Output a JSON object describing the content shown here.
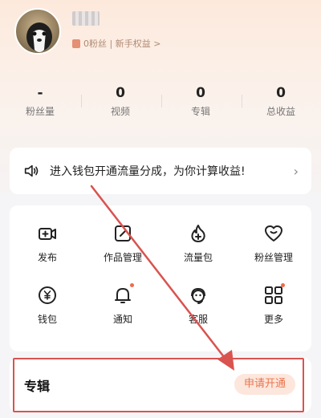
{
  "profile": {
    "fans_text": "0粉丝 | 新手权益 >"
  },
  "stats": [
    {
      "value": "-",
      "label": "粉丝量"
    },
    {
      "value": "0",
      "label": "视频"
    },
    {
      "value": "0",
      "label": "专辑"
    },
    {
      "value": "0",
      "label": "总收益"
    }
  ],
  "notice": {
    "text": "进入钱包开通流量分成，为你计算收益!",
    "chevron": "›"
  },
  "grid": [
    {
      "label": "发布",
      "icon": "video-add-icon",
      "badge": false
    },
    {
      "label": "作品管理",
      "icon": "edit-icon",
      "badge": false
    },
    {
      "label": "流量包",
      "icon": "fire-plus-icon",
      "badge": false
    },
    {
      "label": "粉丝管理",
      "icon": "heart-icon",
      "badge": false
    },
    {
      "label": "钱包",
      "icon": "wallet-coin-icon",
      "badge": false
    },
    {
      "label": "通知",
      "icon": "bell-icon",
      "badge": true
    },
    {
      "label": "客服",
      "icon": "support-icon",
      "badge": false
    },
    {
      "label": "更多",
      "icon": "grid-icon",
      "badge": true
    }
  ],
  "album": {
    "title": "专辑",
    "apply_label": "申请开通"
  },
  "colors": {
    "accent": "#e8764f",
    "annotation_red": "#d9534f"
  }
}
